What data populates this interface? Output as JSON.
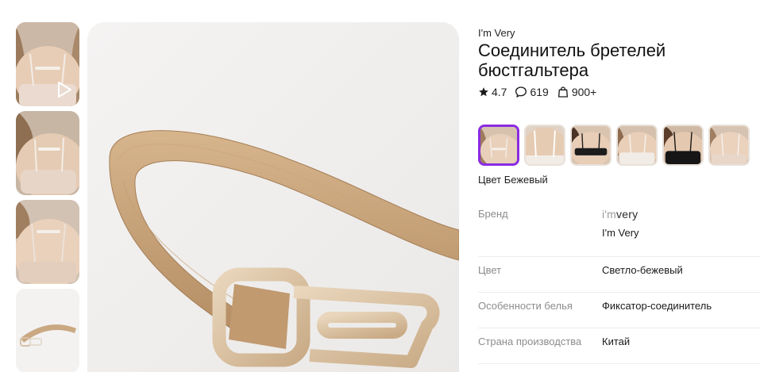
{
  "product": {
    "brand": "I'm Very",
    "title": "Соединитель бретелей бюстгальтера",
    "rating": "4.7",
    "reviews": "619",
    "purchases": "900+"
  },
  "gallery": {
    "thumbnails": [
      {
        "icon": "play-icon"
      },
      {},
      {},
      {}
    ]
  },
  "color": {
    "label": "Цвет Бежевый",
    "swatch_count": 6,
    "accent": "#8a2be2"
  },
  "specs": {
    "brand_key": "Бренд",
    "brand_logo_prefix": "i'm",
    "brand_logo_suffix": "very",
    "brand_value": "I'm Very",
    "color_key": "Цвет",
    "color_value": "Светло-бежевый",
    "feature_key": "Особенности белья",
    "feature_value": "Фиксатор-соединитель",
    "country_key": "Страна производства",
    "country_value": "Китай"
  },
  "icons": {
    "rating": "star-icon",
    "reviews": "speech-bubble-icon",
    "purchases": "shopping-bag-icon"
  }
}
